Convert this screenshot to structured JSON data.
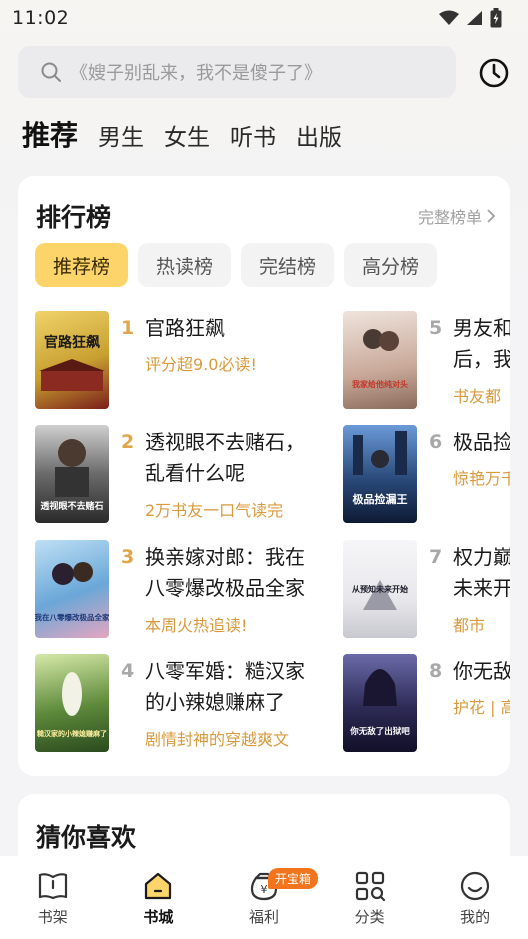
{
  "status_bar": {
    "time": "11:02"
  },
  "search": {
    "placeholder": "《嫂子别乱来，我不是傻子了》"
  },
  "top_tabs": [
    {
      "label": "推荐",
      "active": true
    },
    {
      "label": "男生",
      "active": false
    },
    {
      "label": "女生",
      "active": false
    },
    {
      "label": "听书",
      "active": false
    },
    {
      "label": "出版",
      "active": false
    }
  ],
  "ranking": {
    "title": "排行榜",
    "more_label": "完整榜单",
    "chips": [
      {
        "label": "推荐榜",
        "active": true
      },
      {
        "label": "热读榜",
        "active": false
      },
      {
        "label": "完结榜",
        "active": false
      },
      {
        "label": "高分榜",
        "active": false
      }
    ],
    "books": [
      {
        "rank": "1",
        "title": "官路狂飙",
        "subtitle": "评分超9.0必读!",
        "cover_text": "官路狂飙",
        "cover_color": "#c8a030"
      },
      {
        "rank": "2",
        "title": "透视眼不去赌石，乱看什么呢",
        "subtitle": "2万书友一口气读完",
        "cover_text": "透视眼不去赌石",
        "cover_color": "#5a5a5a"
      },
      {
        "rank": "3",
        "title": "换亲嫁对郎：我在八零爆改极品全家",
        "subtitle": "本周火热追读!",
        "cover_text": "我在八零爆改极品全家",
        "cover_color": "#6aa7d8"
      },
      {
        "rank": "4",
        "title": "八零军婚：糙汉家的小辣媳赚麻了",
        "subtitle": "剧情封神的穿越爽文",
        "cover_text": "糙汉家的小辣媳赚麻了",
        "cover_color": "#5d8a3a"
      },
      {
        "rank": "5",
        "title": "男友和",
        "title2": "后，我",
        "subtitle": "书友都",
        "cover_text": "我家给他纯对头",
        "cover_color": "#c9a99a"
      },
      {
        "rank": "6",
        "title": "极品捡",
        "subtitle": "惊艳万千",
        "cover_text": "极品捡漏王",
        "cover_color": "#2a4a7a"
      },
      {
        "rank": "7",
        "title": "权力巅",
        "title2": "未来开",
        "subtitle": "都市",
        "cover_text": "从预知未来开始",
        "cover_color": "#e8e8ec"
      },
      {
        "rank": "8",
        "title": "你无敌",
        "subtitle": "护花 | 高",
        "cover_text": "你无敌了出狱吧",
        "cover_color": "#2d2a55"
      }
    ]
  },
  "guess": {
    "title": "猜你喜欢"
  },
  "nav": [
    {
      "label": "书架",
      "icon": "bookshelf-icon",
      "active": false
    },
    {
      "label": "书城",
      "icon": "bookstore-icon",
      "active": true
    },
    {
      "label": "福利",
      "icon": "welfare-icon",
      "active": false,
      "badge": "开宝箱"
    },
    {
      "label": "分类",
      "icon": "category-icon",
      "active": false
    },
    {
      "label": "我的",
      "icon": "profile-icon",
      "active": false
    }
  ],
  "colors": {
    "accent": "#fcd46a",
    "rank_top": "#e0a64a",
    "subtitle": "#d89a3c",
    "badge": "#f2751e"
  }
}
